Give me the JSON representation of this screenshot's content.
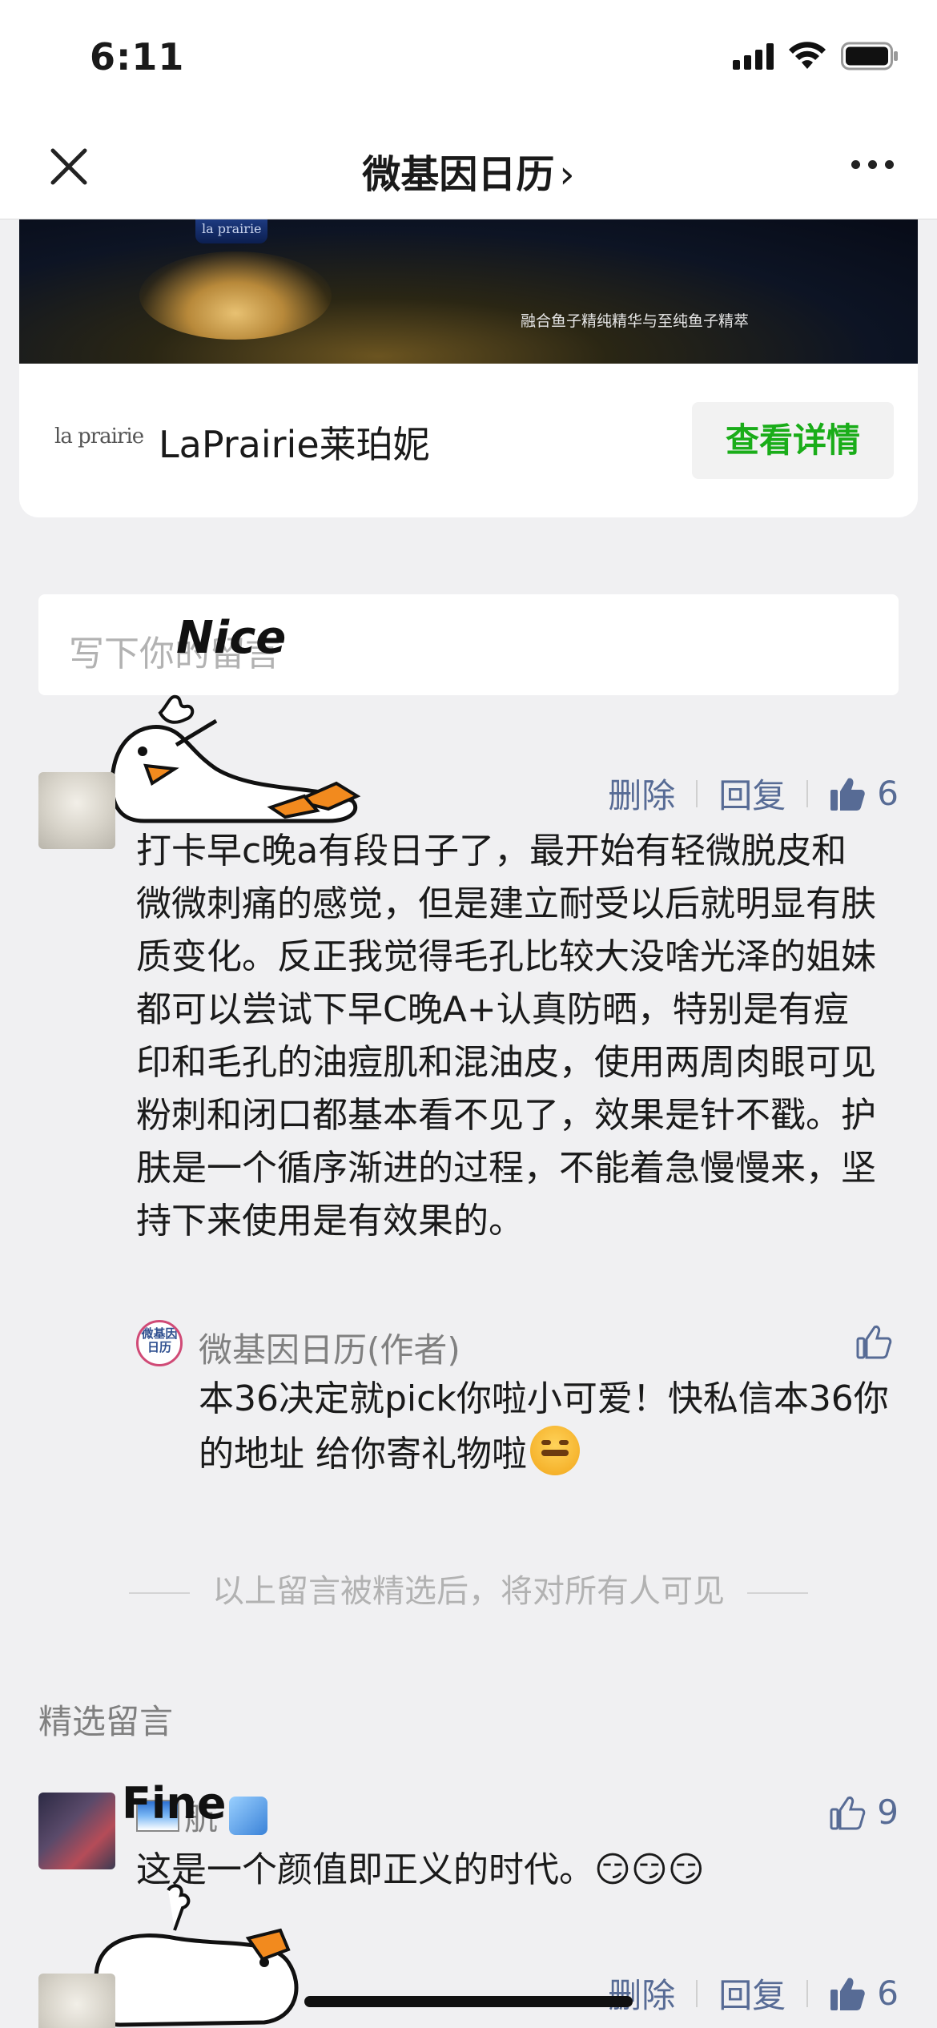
{
  "status_bar": {
    "time": "6:11"
  },
  "nav": {
    "title": "微基因日历",
    "chevron": "›"
  },
  "ad": {
    "bottle_label": "la prairie",
    "caption": "融合鱼子精纯精华与至纯鱼子精萃",
    "logo": "la prairie",
    "brand": "LaPrairie莱珀妮",
    "button": "查看详情"
  },
  "comment_input": {
    "placeholder": "写下你的留言"
  },
  "stickers": {
    "top": "Nice",
    "bottom": "Fine"
  },
  "comments": [
    {
      "delete": "删除",
      "reply": "回复",
      "likes": "6",
      "text": "打卡早c晚a有段日子了，最开始有轻微脱皮和微微刺痛的感觉，但是建立耐受以后就明显有肤质变化。反正我觉得毛孔比较大没啥光泽的姐妹都可以尝试下早C晚A+认真防晒，特别是有痘印和毛孔的油痘肌和混油皮，使用两周肉眼可见粉刺和闭口都基本看不见了，效果是针不戳。护肤是一个循序渐进的过程，不能着急慢慢来，坚持下来使用是有效果的。",
      "author_reply": {
        "avatar_text": "微基因日历",
        "author": "微基因日历(作者)",
        "text": "本36决定就pick你啦小可爱！快私信本36你的地址 给你寄礼物啦"
      }
    }
  ],
  "divider_note": "以上留言被精选后，将对所有人可见",
  "featured": {
    "section_title": "精选留言",
    "items": [
      {
        "name": "航",
        "likes": "9",
        "text": "这是一个颜值即正义的时代。😏😏😏"
      },
      {
        "delete": "删除",
        "reply": "回复",
        "likes": "6"
      }
    ]
  },
  "colors": {
    "link": "#576b95",
    "green": "#1aad19",
    "background": "#f0f0f2"
  }
}
